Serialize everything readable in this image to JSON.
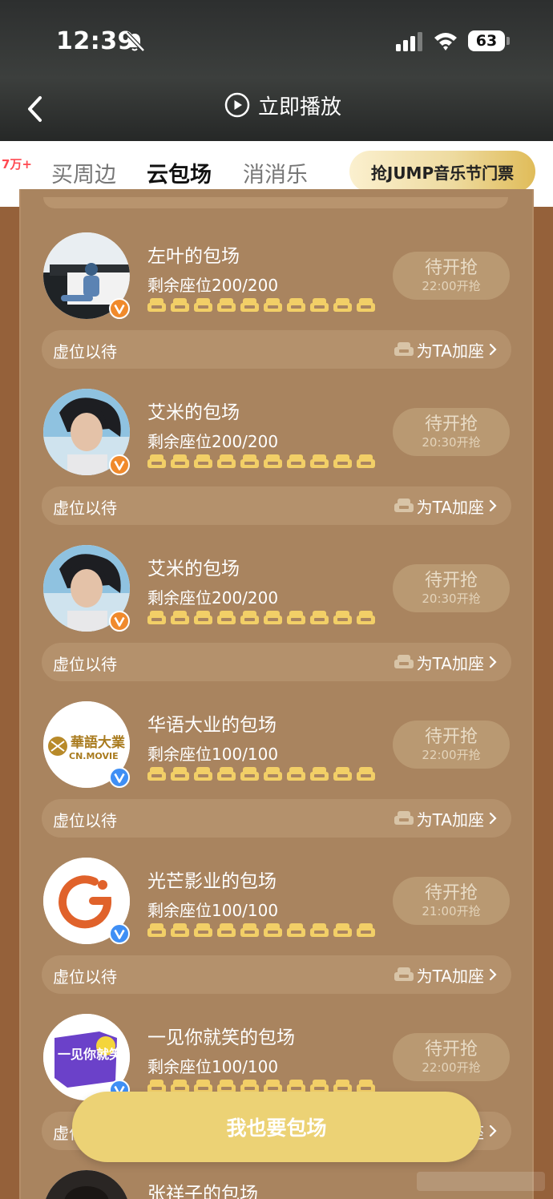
{
  "status_bar": {
    "time": "12:39",
    "battery": "63"
  },
  "header": {
    "play_now_label": "立即播放"
  },
  "tabs": {
    "badge": "7万+",
    "items": [
      {
        "label": "买周边",
        "active": false
      },
      {
        "label": "云包场",
        "active": true
      },
      {
        "label": "消消乐",
        "active": false
      }
    ],
    "promo_label": "抢JUMP音乐节门票"
  },
  "screenings": [
    {
      "title": "左叶的包场",
      "seats": "剩余座位200/200",
      "status": "待开抢",
      "time": "22:00开抢",
      "verify": "orange"
    },
    {
      "title": "艾米的包场",
      "seats": "剩余座位200/200",
      "status": "待开抢",
      "time": "20:30开抢",
      "verify": "orange"
    },
    {
      "title": "艾米的包场",
      "seats": "剩余座位200/200",
      "status": "待开抢",
      "time": "20:30开抢",
      "verify": "orange"
    },
    {
      "title": "华语大业的包场",
      "seats": "剩余座位100/100",
      "status": "待开抢",
      "time": "22:00开抢",
      "verify": "blue",
      "avatar_text": "華語大業",
      "avatar_subtext": "CN.MOVIE"
    },
    {
      "title": "光芒影业的包场",
      "seats": "剩余座位100/100",
      "status": "待开抢",
      "time": "21:00开抢",
      "verify": "blue"
    },
    {
      "title": "一见你就笑的包场",
      "seats": "剩余座位100/100",
      "status": "待开抢",
      "time": "22:00开抢",
      "verify": "blue",
      "avatar_text": "一见你就笑"
    },
    {
      "title": "张祥子的包场"
    }
  ],
  "row_footer": {
    "left_label": "虚位以待",
    "right_label": "为TA加座"
  },
  "cta_label": "我也要包场",
  "colors": {
    "accent": "#ecd275",
    "verify_orange": "#f08a2c",
    "verify_blue": "#3f8ff5",
    "page_bg": "#95613a"
  }
}
